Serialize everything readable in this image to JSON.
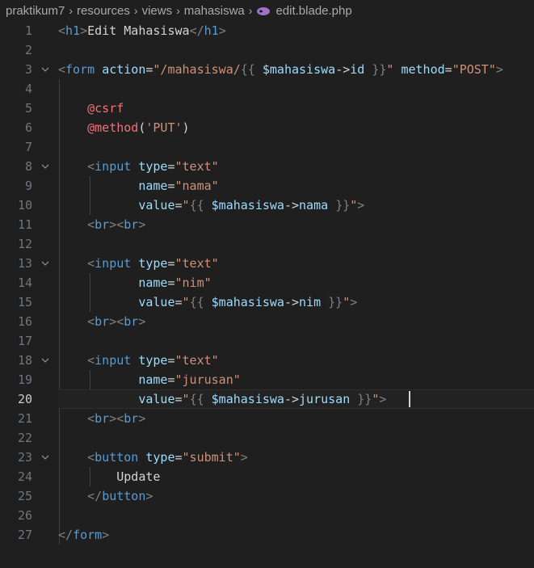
{
  "breadcrumb": {
    "parts": [
      "praktikum7",
      "resources",
      "views",
      "mahasiswa"
    ],
    "file": "edit.blade.php",
    "file_icon": "php-elephant-icon"
  },
  "editor": {
    "active_line": 20,
    "lines": [
      {
        "n": "1",
        "text": "<h1>Edit Mahasiswa</h1>"
      },
      {
        "n": "2",
        "text": ""
      },
      {
        "n": "3",
        "text": "<form action=\"/mahasiswa/{{ $mahasiswa->id }}\" method=\"POST\">"
      },
      {
        "n": "4",
        "text": ""
      },
      {
        "n": "5",
        "text": "    @csrf"
      },
      {
        "n": "6",
        "text": "    @method('PUT')"
      },
      {
        "n": "7",
        "text": ""
      },
      {
        "n": "8",
        "text": "    <input type=\"text\""
      },
      {
        "n": "9",
        "text": "           name=\"nama\""
      },
      {
        "n": "10",
        "text": "           value=\"{{ $mahasiswa->nama }}\">"
      },
      {
        "n": "11",
        "text": "    <br><br>"
      },
      {
        "n": "12",
        "text": ""
      },
      {
        "n": "13",
        "text": "    <input type=\"text\""
      },
      {
        "n": "14",
        "text": "           name=\"nim\""
      },
      {
        "n": "15",
        "text": "           value=\"{{ $mahasiswa->nim }}\">"
      },
      {
        "n": "16",
        "text": "    <br><br>"
      },
      {
        "n": "17",
        "text": ""
      },
      {
        "n": "18",
        "text": "    <input type=\"text\""
      },
      {
        "n": "19",
        "text": "           name=\"jurusan\""
      },
      {
        "n": "20",
        "text": "           value=\"{{ $mahasiswa->jurusan }}\">"
      },
      {
        "n": "21",
        "text": "    <br><br>"
      },
      {
        "n": "22",
        "text": ""
      },
      {
        "n": "23",
        "text": "    <button type=\"submit\">"
      },
      {
        "n": "24",
        "text": "        Update"
      },
      {
        "n": "25",
        "text": "    </button>"
      },
      {
        "n": "26",
        "text": ""
      },
      {
        "n": "27",
        "text": "</form>"
      }
    ]
  },
  "colors": {
    "background": "#1f1f1f",
    "tag": "#569cd6",
    "attribute": "#9cdcfe",
    "string": "#ce9178",
    "directive": "#f07178",
    "line_number": "#6e7681"
  }
}
